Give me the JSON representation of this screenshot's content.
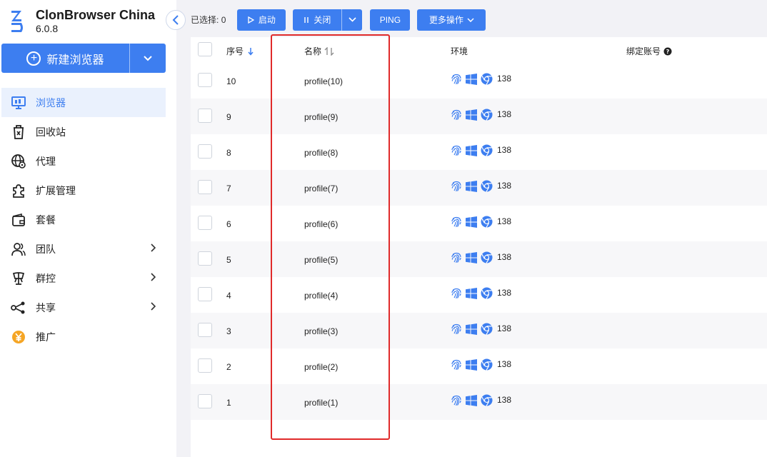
{
  "brand": {
    "name": "ClonBrowser China",
    "version": "6.0.8"
  },
  "new_button": {
    "label": "新建浏览器"
  },
  "nav": [
    {
      "label": "浏览器",
      "icon": "monitor-icon",
      "active": true,
      "has_chevron": false
    },
    {
      "label": "回收站",
      "icon": "trash-icon",
      "active": false,
      "has_chevron": false
    },
    {
      "label": "代理",
      "icon": "globe-icon",
      "active": false,
      "has_chevron": false
    },
    {
      "label": "扩展管理",
      "icon": "puzzle-icon",
      "active": false,
      "has_chevron": false
    },
    {
      "label": "套餐",
      "icon": "wallet-icon",
      "active": false,
      "has_chevron": false
    },
    {
      "label": "团队",
      "icon": "team-icon",
      "active": false,
      "has_chevron": true
    },
    {
      "label": "群控",
      "icon": "control-icon",
      "active": false,
      "has_chevron": true
    },
    {
      "label": "共享",
      "icon": "share-icon",
      "active": false,
      "has_chevron": true
    },
    {
      "label": "推广",
      "icon": "yen-icon",
      "active": false,
      "has_chevron": false
    }
  ],
  "toolbar": {
    "selected_label": "已选择:",
    "selected_count": "0",
    "start_label": "启动",
    "close_label": "关闭",
    "ping_label": "PING",
    "more_label": "更多操作"
  },
  "table": {
    "headers": {
      "index": "序号",
      "name": "名称",
      "env": "环境",
      "account": "绑定账号"
    },
    "rows": [
      {
        "index": "10",
        "name": "profile(10)",
        "env_version": "138"
      },
      {
        "index": "9",
        "name": "profile(9)",
        "env_version": "138"
      },
      {
        "index": "8",
        "name": "profile(8)",
        "env_version": "138"
      },
      {
        "index": "7",
        "name": "profile(7)",
        "env_version": "138"
      },
      {
        "index": "6",
        "name": "profile(6)",
        "env_version": "138"
      },
      {
        "index": "5",
        "name": "profile(5)",
        "env_version": "138"
      },
      {
        "index": "4",
        "name": "profile(4)",
        "env_version": "138"
      },
      {
        "index": "3",
        "name": "profile(3)",
        "env_version": "138"
      },
      {
        "index": "2",
        "name": "profile(2)",
        "env_version": "138"
      },
      {
        "index": "1",
        "name": "profile(1)",
        "env_version": "138"
      }
    ]
  },
  "colors": {
    "accent": "#3d7ef0",
    "highlight": "#e02a2a"
  }
}
